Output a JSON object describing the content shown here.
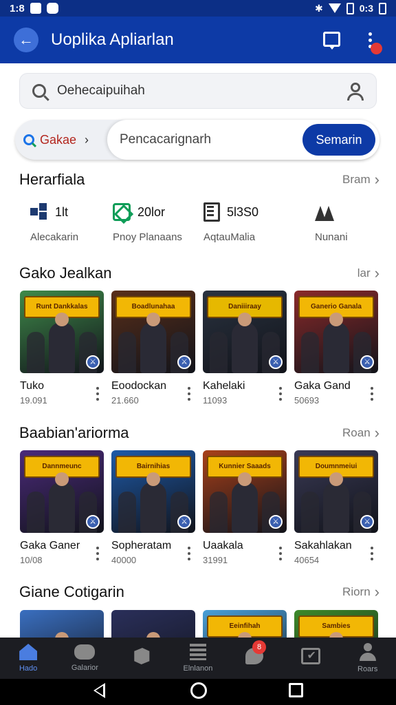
{
  "status_bar": {
    "time": "1:8",
    "right_text": "0:3"
  },
  "app_bar": {
    "title": "Uoplika Apliarlan"
  },
  "search": {
    "text": "Oehecaipuihah"
  },
  "filter": {
    "category": "Gakae",
    "placeholder": "Pencacarignarh",
    "button": "Semarin"
  },
  "stats_section": {
    "title": "Herarfiala",
    "see_more": "Bram",
    "items": [
      {
        "icon": "grid-icon",
        "value": "1lt",
        "label": "Alecakarin"
      },
      {
        "icon": "cube-icon",
        "value": "20lor",
        "label": "Pnoy Planaans"
      },
      {
        "icon": "document-icon",
        "value": "5l3S0",
        "label": "AqtauMalia"
      },
      {
        "icon": "mountain-icon",
        "value": "",
        "label": "Nunani"
      }
    ]
  },
  "section1": {
    "title": "Gako Jealkan",
    "see_more": "lar",
    "games": [
      {
        "name": "Tuko",
        "sub": "19.091",
        "art": "Runt Dankkalas",
        "bg": "#3f8a4a",
        "accent": "#f2b705"
      },
      {
        "name": "Eoodockan",
        "sub": "21.660",
        "art": "Boadlunahaa",
        "bg": "#5a2f1a",
        "accent": "#f2b705"
      },
      {
        "name": "Kahelaki",
        "sub": "11093",
        "art": "Daniiiraay",
        "bg": "#2a3340",
        "accent": "#e6b800"
      },
      {
        "name": "Gaka Gand",
        "sub": "50693",
        "art": "Ganerio Ganala",
        "bg": "#8a2a2a",
        "accent": "#f2b705"
      }
    ]
  },
  "section2": {
    "title": "Baabian'ariorma",
    "see_more": "Roan",
    "games": [
      {
        "name": "Gaka Ganer",
        "sub": "10/08",
        "art": "Dannmeunc",
        "bg": "#4b2a7a",
        "accent": "#f2b705"
      },
      {
        "name": "Sopheratam",
        "sub": "40000",
        "art": "Bairnihias",
        "bg": "#1e5aa8",
        "accent": "#f2b705"
      },
      {
        "name": "Uaakala",
        "sub": "31991",
        "art": "Kunnier Saaads",
        "bg": "#a8401a",
        "accent": "#f2b705"
      },
      {
        "name": "Sakahlakan",
        "sub": "40654",
        "art": "Doumnmeiui",
        "bg": "#3a3a55",
        "accent": "#f2b705"
      }
    ]
  },
  "section3": {
    "title": "Giane Cotigarin",
    "see_more": "Riorn",
    "games": [
      {
        "name": "",
        "sub": "",
        "art": "",
        "bg": "#3a6fc0",
        "accent": "#f2b705"
      },
      {
        "name": "",
        "sub": "",
        "art": "",
        "bg": "#2a2f5a",
        "accent": "#f2b705"
      },
      {
        "name": "",
        "sub": "",
        "art": "Eeinfihah",
        "bg": "#4aa0d8",
        "accent": "#f2b705"
      },
      {
        "name": "",
        "sub": "",
        "art": "Sambies",
        "bg": "#3d8a2a",
        "accent": "#f2b705"
      }
    ]
  },
  "bottom_nav": {
    "items": [
      {
        "label": "Hado",
        "icon": "home-icon",
        "active": true
      },
      {
        "label": "Galarior",
        "icon": "gamepad-icon",
        "active": false
      },
      {
        "label": "",
        "icon": "box-icon",
        "active": false
      },
      {
        "label": "Elnlanon",
        "icon": "list-icon",
        "active": false
      },
      {
        "label": "",
        "icon": "chat-icon",
        "active": false
      },
      {
        "label": "",
        "icon": "check-icon",
        "active": false
      },
      {
        "label": "Roars",
        "icon": "user-icon",
        "active": false
      }
    ],
    "badge": "8"
  },
  "colors": {
    "primary": "#0d3aa6",
    "status": "#0c2f86",
    "accent_red": "#e53935",
    "nav_bg": "#1c1d22"
  }
}
